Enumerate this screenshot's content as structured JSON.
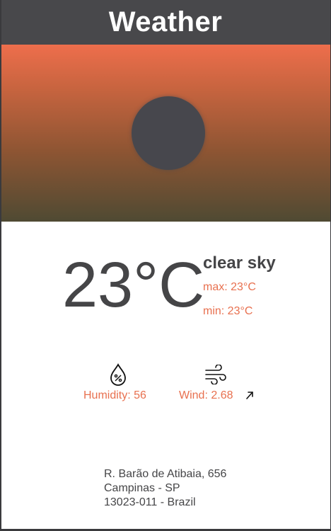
{
  "header": {
    "title": "Weather"
  },
  "weather": {
    "temperature": "23°C",
    "description": "clear sky",
    "max": "max: 23°C",
    "min": "min: 23°C",
    "humidity_label": "Humidity: 56",
    "wind_label": "Wind: 2.68"
  },
  "address": {
    "street": "R. Barão de Atibaia, 656",
    "city": "Campinas - SP",
    "postal": "13023-011 - Brazil"
  },
  "icons": {
    "hero": "sun-icon",
    "humidity": "humidity-drop-icon",
    "wind": "wind-icon",
    "wind_direction": "wind-direction-arrow-icon"
  },
  "colors": {
    "header_bg": "#48484b",
    "accent": "#e8704f",
    "text": "#454547",
    "sky_top": "#ee6e4c",
    "sky_bottom": "#4f4a33"
  }
}
